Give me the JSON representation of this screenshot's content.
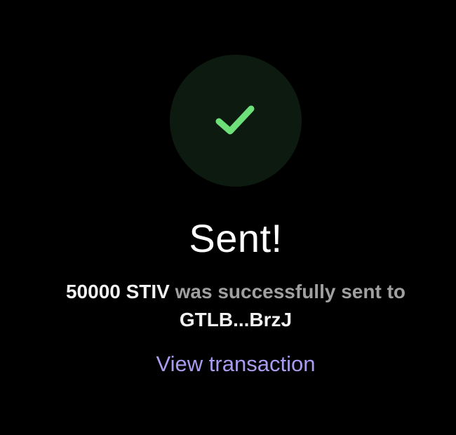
{
  "status": {
    "title": "Sent!",
    "icon": "checkmark-icon",
    "icon_color": "#6ee07a",
    "circle_color": "#0d1a0f"
  },
  "message": {
    "amount": "50000 STIV",
    "text": " was successfully sent to",
    "recipient": "GTLB...BrzJ"
  },
  "actions": {
    "view_transaction_label": "View transaction"
  },
  "colors": {
    "background": "#000000",
    "accent_link": "#a99cef",
    "muted_text": "#a0a0a0",
    "primary_text": "#ffffff"
  }
}
